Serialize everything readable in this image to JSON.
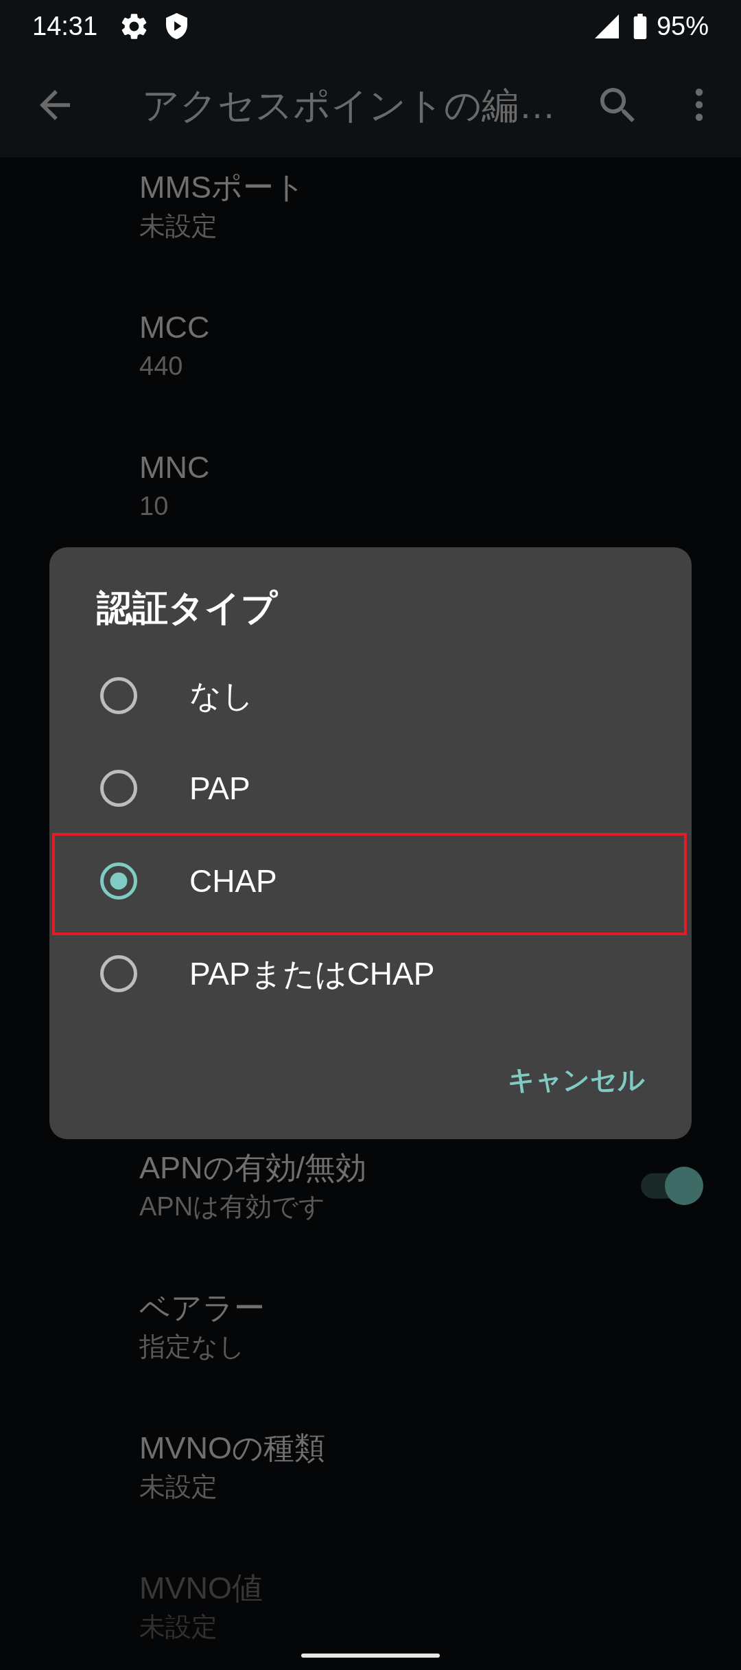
{
  "status_bar": {
    "time": "14:31",
    "battery": "95%"
  },
  "app_bar": {
    "title": "アクセスポイントの編…"
  },
  "settings_top": [
    {
      "title": "MMSポート",
      "summary": "未設定",
      "disabled": false
    },
    {
      "title": "MCC",
      "summary": "440",
      "disabled": false
    },
    {
      "title": "MNC",
      "summary": "10",
      "disabled": false
    }
  ],
  "settings_bottom": [
    {
      "kind": "switch",
      "title": "APNの有効/無効",
      "summary": "APNは有効です",
      "disabled": false,
      "on": true
    },
    {
      "kind": "text",
      "title": "ベアラー",
      "summary": "指定なし",
      "disabled": false
    },
    {
      "kind": "text",
      "title": "MVNOの種類",
      "summary": "未設定",
      "disabled": false
    },
    {
      "kind": "text",
      "title": "MVNO値",
      "summary": "未設定",
      "disabled": true
    }
  ],
  "dialog": {
    "title": "認証タイプ",
    "options": [
      {
        "label": "なし",
        "selected": false,
        "highlighted": false
      },
      {
        "label": "PAP",
        "selected": false,
        "highlighted": false
      },
      {
        "label": "CHAP",
        "selected": true,
        "highlighted": true
      },
      {
        "label": "PAPまたはCHAP",
        "selected": false,
        "highlighted": false
      }
    ],
    "buttons": [
      "キャンセル"
    ]
  }
}
